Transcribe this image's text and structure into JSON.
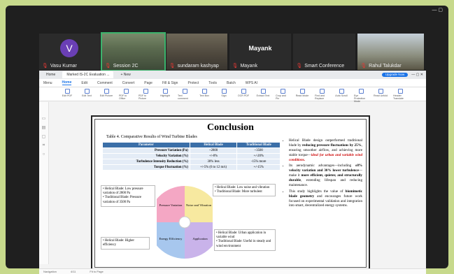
{
  "participants": [
    {
      "name": "Vasu Kumar",
      "initial": "V"
    },
    {
      "name": "Session 2C"
    },
    {
      "name": "sundaram kashyap"
    },
    {
      "name": "Mayank",
      "big": "Mayank"
    },
    {
      "name": "Smart Conference"
    },
    {
      "name": "Rahul Talukdar"
    }
  ],
  "browser": {
    "tab1": "Home",
    "tab2": "Marked IS-2C Evaluation ...",
    "new_tab": "+  New",
    "upgrade": "Upgrade Now"
  },
  "menu": [
    "Menu",
    "Home",
    "Edit",
    "Comment",
    "Convert",
    "Page",
    "Fill & Sign",
    "Protect",
    "Tools",
    "Batch",
    "WPS AI"
  ],
  "toolbar": [
    "Edit PDF",
    "Edit Text",
    "Edit Picture",
    "PDF to Office",
    "PDF to Picture",
    "Highlight",
    "Text comment",
    "Text Box",
    "Sign",
    "OCR PDF",
    "Extract Text",
    "Crop and Pin",
    "Read Mode",
    "Find and Replace",
    "Auto Scroll",
    "Eye Protection Mode",
    "Read Unfold",
    "Header Translate"
  ],
  "slide": {
    "title": "Conclusion",
    "table_caption": "Table 4. Comparative Results of Wind Turbine Blades",
    "headers": [
      "Parameter",
      "Helical Blade",
      "Traditional Blade"
    ],
    "rows": [
      [
        "Pressure Variation (Pa)",
        "~2800",
        "~3500"
      ],
      [
        "Velocity Variation (%)",
        "+/-8%",
        "+/-20%"
      ],
      [
        "Turbulence Intensity Reduction (%)",
        "30% less",
        "-15% more"
      ],
      [
        "Torque Fluctuation (%)",
        "+/-5% (6 to 12 m/s)",
        "+/-15%"
      ]
    ],
    "pie": [
      "Pressure Variation",
      "Noise and Vibration",
      "Energy Efficiency",
      "Application"
    ],
    "box_tl": "• Helical Blade: Low pressure variation of 2800 Pa\n• Traditional Blade: Pressure variation of 3500 Pa",
    "box_tr": "• Helical Blade: Low noise and vibration\n• Traditional Blade: More turbulent",
    "box_bl": "• Helical Blade: Higher efficiency",
    "box_br": "• Helical Blade: Urban application in variable wind\n• Traditional Blade: Useful in steady and wind environment",
    "b1a": "Helical Blade design outperformed traditional blade by ",
    "b1b": "reducing pressure fluctuations by 25%",
    "b1c": ", ensuring smoother airflow, and achieving more stable torque—",
    "b1d": "ideal for urban and variable wind conditions.",
    "b2a": "Its aerodynamic advantages—including ",
    "b2b": "±8% velocity variation and 30% lower turbulence",
    "b2c": "—make it ",
    "b2d": "more efficient, quieter, and structurally durable",
    "b2e": ", extending lifespan and reducing maintenance.",
    "b3a": "This study highlights the value of ",
    "b3b": "biomimetic blade geometry",
    "b3c": " and encourages future work focused on experimental validation and integration into smart, decentralized energy systems."
  },
  "status": {
    "nav": "Navigation",
    "page": "4/11",
    "fit": "Fit to Page"
  }
}
